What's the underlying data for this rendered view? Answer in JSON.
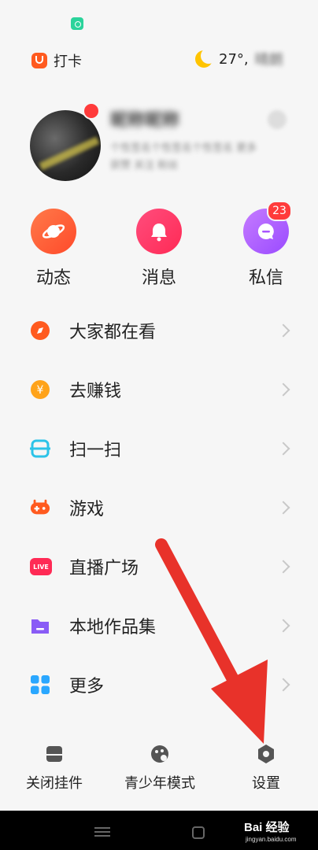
{
  "top": {
    "checkin_label": "打卡",
    "weather_temp": "27°,",
    "weather_desc": "晴朗"
  },
  "profile": {
    "name": "昵称昵称",
    "bio_line1": "个性签名个性签名个性签名",
    "bio_more": "更多",
    "bio_line2": "获赞 关注 粉丝"
  },
  "quick_actions": [
    {
      "label": "动态",
      "icon": "planet-icon"
    },
    {
      "label": "消息",
      "icon": "bell-icon"
    },
    {
      "label": "私信",
      "icon": "chat-bubble-icon",
      "badge": "23"
    }
  ],
  "menu": [
    {
      "label": "大家都在看",
      "icon": "compass-icon",
      "color": "#ff5a1f"
    },
    {
      "label": "去赚钱",
      "icon": "yuan-coin-icon",
      "color": "#ffa31a"
    },
    {
      "label": "扫一扫",
      "icon": "scan-icon",
      "color": "#2cc3e8"
    },
    {
      "label": "游戏",
      "icon": "gamepad-icon",
      "color": "#ff5a1f"
    },
    {
      "label": "直播广场",
      "icon": "live-icon",
      "color": "#ff2a55",
      "icon_text": "LIVE"
    },
    {
      "label": "本地作品集",
      "icon": "folder-icon",
      "color": "#8a5cf6"
    },
    {
      "label": "更多",
      "icon": "grid-icon",
      "color": "#2aa7ff"
    }
  ],
  "bottom_bar": {
    "close_widget": "关闭挂件",
    "teen_mode": "青少年模式",
    "settings": "设置"
  },
  "watermark": {
    "brand": "Bai 经验",
    "url": "jingyan.baidu.com"
  },
  "annotation": {
    "arrow_color": "#e8322a"
  }
}
